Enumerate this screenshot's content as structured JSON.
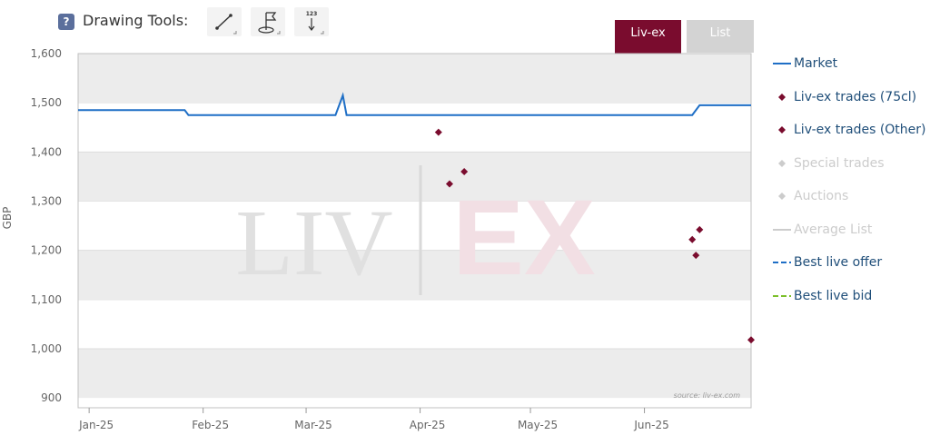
{
  "toolbar": {
    "help_label": "?",
    "drawing_tools_label": "Drawing Tools:",
    "number_tool_label": "123"
  },
  "tabs": [
    {
      "label": "Liv-ex",
      "active": true,
      "color": "#7a0c2e"
    },
    {
      "label": "List",
      "active": false,
      "color": "#d3d3d3"
    }
  ],
  "chart_data": {
    "type": "line",
    "ylabel": "GBP",
    "ylim": [
      880,
      1600
    ],
    "y_ticks": [
      900,
      1000,
      1100,
      1200,
      1300,
      1400,
      1500,
      1600
    ],
    "y_tick_labels": [
      "900",
      "1,000",
      "1,100",
      "1,200",
      "1,300",
      "1,400",
      "1,500",
      "1,600"
    ],
    "xlim": [
      "2024-12-29",
      "2025-06-30"
    ],
    "x_ticks": [
      "2025-01-01",
      "2025-02-01",
      "2025-03-01",
      "2025-04-01",
      "2025-05-01",
      "2025-06-01"
    ],
    "x_tick_labels": [
      "Jan-25",
      "Feb-25",
      "Mar-25",
      "Apr-25",
      "May-25",
      "Jun-25"
    ],
    "grid": true,
    "legend_position": "right",
    "watermark": "LIV|EX",
    "source": "source: liv-ex.com",
    "series": [
      {
        "name": "Market",
        "type": "line",
        "color": "#1f6fc6",
        "points": [
          [
            "2024-12-29",
            1485
          ],
          [
            "2025-01-27",
            1485
          ],
          [
            "2025-01-28",
            1475
          ],
          [
            "2025-03-09",
            1475
          ],
          [
            "2025-03-11",
            1515
          ],
          [
            "2025-03-12",
            1475
          ],
          [
            "2025-06-14",
            1475
          ],
          [
            "2025-06-16",
            1495
          ],
          [
            "2025-06-30",
            1495
          ]
        ]
      },
      {
        "name": "Liv-ex trades (75cl)",
        "type": "scatter",
        "color": "#7a0c2e",
        "points": [
          [
            "2025-04-06",
            1440
          ],
          [
            "2025-04-09",
            1335
          ],
          [
            "2025-04-13",
            1360
          ],
          [
            "2025-06-14",
            1222
          ],
          [
            "2025-06-15",
            1190
          ],
          [
            "2025-06-16",
            1242
          ],
          [
            "2025-06-30",
            1018
          ]
        ]
      },
      {
        "name": "Liv-ex trades (Other)",
        "type": "scatter",
        "color": "#7a0c2e",
        "points": []
      },
      {
        "name": "Special trades",
        "type": "scatter",
        "color": "#cccccc",
        "points": []
      },
      {
        "name": "Auctions",
        "type": "scatter",
        "color": "#cccccc",
        "points": []
      },
      {
        "name": "Average List",
        "type": "line",
        "color": "#cccccc",
        "points": []
      },
      {
        "name": "Best live offer",
        "type": "dashed",
        "color": "#1f6fc6",
        "points": []
      },
      {
        "name": "Best live bid",
        "type": "dashed",
        "color": "#7cbf2a",
        "points": []
      }
    ]
  },
  "legend": [
    {
      "label": "Market",
      "marker": "line",
      "color": "#1f6fc6",
      "text_color": "#1f4e79"
    },
    {
      "label": "Liv-ex trades (75cl)",
      "marker": "diamond",
      "color": "#7a0c2e",
      "text_color": "#1f4e79"
    },
    {
      "label": "Liv-ex trades (Other)",
      "marker": "diamond",
      "color": "#7a0c2e",
      "text_color": "#1f4e79"
    },
    {
      "label": "Special trades",
      "marker": "diamond",
      "color": "#cccccc",
      "text_color": "#cccccc"
    },
    {
      "label": "Auctions",
      "marker": "diamond",
      "color": "#cccccc",
      "text_color": "#cccccc"
    },
    {
      "label": "Average List",
      "marker": "line",
      "color": "#cccccc",
      "text_color": "#cccccc"
    },
    {
      "label": "Best live offer",
      "marker": "dashed",
      "color": "#1f6fc6",
      "text_color": "#1f4e79"
    },
    {
      "label": "Best live bid",
      "marker": "dashed",
      "color": "#7cbf2a",
      "text_color": "#1f4e79"
    }
  ]
}
